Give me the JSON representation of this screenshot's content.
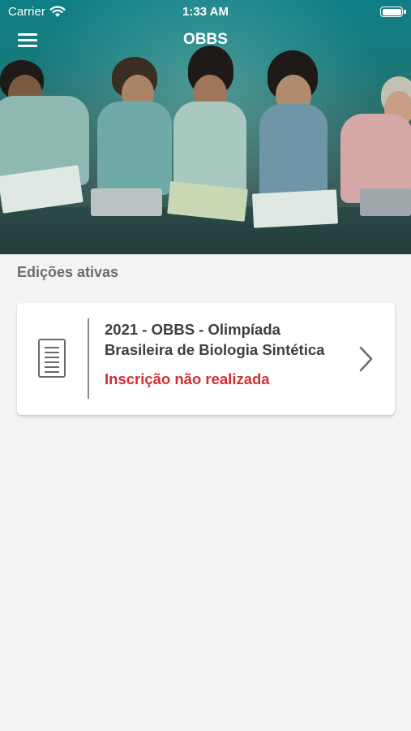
{
  "status_bar": {
    "carrier": "Carrier",
    "time": "1:33 AM"
  },
  "header": {
    "title": "OBBS"
  },
  "section": {
    "title": "Edições ativas"
  },
  "editions": [
    {
      "title": "2021 - OBBS - Olimpíada Brasileira de Biologia Sintética",
      "status": "Inscrição não realizada"
    }
  ],
  "colors": {
    "accent_teal": "#0f7f86",
    "status_red": "#d32d32",
    "background": "#f2f3f5"
  },
  "icons": {
    "menu": "hamburger-icon",
    "document": "document-icon",
    "chevron": "chevron-right-icon"
  }
}
